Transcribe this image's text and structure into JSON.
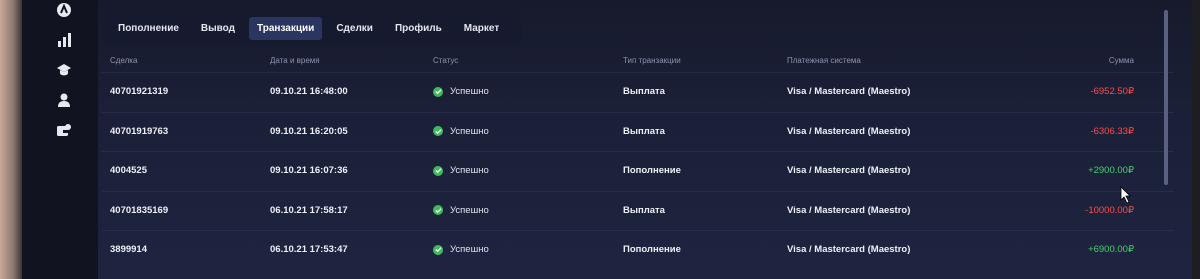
{
  "sidebar": {
    "icons": [
      "logo-icon",
      "chart-icon",
      "graduation-cap-icon",
      "user-icon",
      "wallet-icon"
    ]
  },
  "tabs": [
    {
      "label": "Пополнение",
      "active": false
    },
    {
      "label": "Вывод",
      "active": false
    },
    {
      "label": "Транзакции",
      "active": true
    },
    {
      "label": "Сделки",
      "active": false
    },
    {
      "label": "Профиль",
      "active": false
    },
    {
      "label": "Маркет",
      "active": false
    }
  ],
  "table": {
    "headers": {
      "deal": "Сделка",
      "datetime": "Дата и время",
      "status": "Статус",
      "type": "Тип транзакции",
      "payment": "Платежная система",
      "amount": "Сумма"
    },
    "rows": [
      {
        "deal": "40701921319",
        "datetime": "09.10.21 16:48:00",
        "status": "Успешно",
        "type": "Выплата",
        "payment": "Visa / Mastercard (Maestro)",
        "amount": "-6952.50₽",
        "sign": "neg"
      },
      {
        "deal": "40701919763",
        "datetime": "09.10.21 16:20:05",
        "status": "Успешно",
        "type": "Выплата",
        "payment": "Visa / Mastercard (Maestro)",
        "amount": "-6306.33₽",
        "sign": "neg"
      },
      {
        "deal": "4004525",
        "datetime": "09.10.21 16:07:36",
        "status": "Успешно",
        "type": "Пополнение",
        "payment": "Visa / Mastercard (Maestro)",
        "amount": "+2900.00₽",
        "sign": "pos"
      },
      {
        "deal": "40701835169",
        "datetime": "06.10.21 17:58:17",
        "status": "Успешно",
        "type": "Выплата",
        "payment": "Visa / Mastercard (Maestro)",
        "amount": "-10000.00₽",
        "sign": "neg"
      },
      {
        "deal": "3899914",
        "datetime": "06.10.21 17:53:47",
        "status": "Успешно",
        "type": "Пополнение",
        "payment": "Visa / Mastercard (Maestro)",
        "amount": "+6900.00₽",
        "sign": "pos"
      }
    ]
  },
  "colors": {
    "negative": "#ff4b4b",
    "positive": "#46d06a",
    "success": "#3dbd5a",
    "active_tab": "#2a3560"
  }
}
